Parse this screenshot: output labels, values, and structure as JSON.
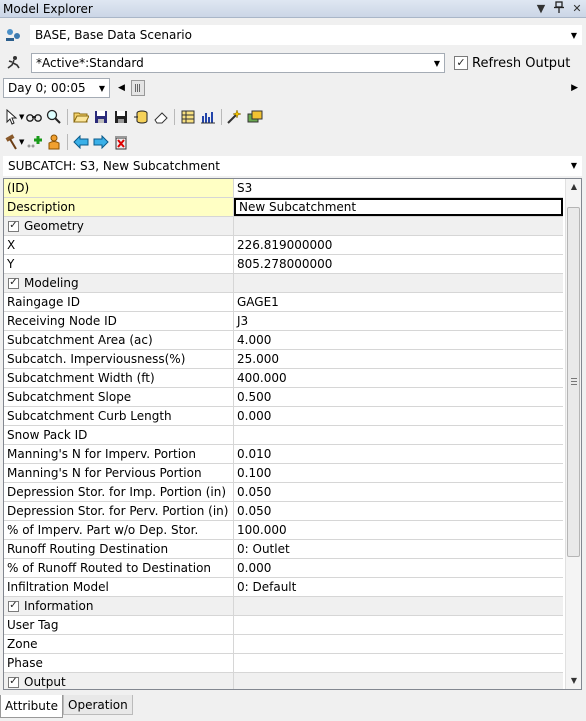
{
  "window": {
    "title": "Model Explorer",
    "pin_glyph": "ᵽ",
    "dropdown_glyph": "▼",
    "close_glyph": "✕"
  },
  "scenario": {
    "value": "BASE, Base Data Scenario"
  },
  "active_set": {
    "value": "*Active*:Standard",
    "refresh_label": "Refresh Output",
    "refresh_checked": true
  },
  "time": {
    "value": "Day 0;  00:05"
  },
  "selection": {
    "value": "SUBCATCH: S3, New Subcatchment"
  },
  "rows": [
    {
      "name": "(ID)",
      "value": "S3",
      "style": "yellow"
    },
    {
      "name": "Description",
      "value": "New Subcatchment",
      "style": "yellow-edit"
    },
    {
      "name": "Geometry",
      "category": true
    },
    {
      "name": "X",
      "value": "226.819000000"
    },
    {
      "name": "Y",
      "value": "805.278000000"
    },
    {
      "name": "Modeling",
      "category": true
    },
    {
      "name": "Raingage ID",
      "value": "GAGE1"
    },
    {
      "name": "Receiving Node ID",
      "value": "J3"
    },
    {
      "name": "Subcatchment Area (ac)",
      "value": "4.000"
    },
    {
      "name": "Subcatch. Imperviousness(%)",
      "value": "25.000"
    },
    {
      "name": "Subcatchment Width (ft)",
      "value": "400.000"
    },
    {
      "name": "Subcatchment Slope",
      "value": "0.500"
    },
    {
      "name": "Subcatchment Curb Length",
      "value": "0.000"
    },
    {
      "name": "Snow Pack ID",
      "value": ""
    },
    {
      "name": "Manning's N for Imperv. Portion",
      "value": "0.010"
    },
    {
      "name": "Manning's N for Pervious Portion",
      "value": "0.100"
    },
    {
      "name": "Depression Stor. for Imp. Portion (in)",
      "value": "0.050"
    },
    {
      "name": "Depression Stor. for Perv. Portion (in)",
      "value": "0.050"
    },
    {
      "name": "% of Imperv. Part w/o Dep. Stor.",
      "value": "100.000"
    },
    {
      "name": "Runoff Routing Destination",
      "value": "0: Outlet"
    },
    {
      "name": "% of Runoff Routed to Destination",
      "value": "0.000"
    },
    {
      "name": "Infiltration Model",
      "value": "0: Default"
    },
    {
      "name": "Information",
      "category": true
    },
    {
      "name": "User Tag",
      "value": ""
    },
    {
      "name": "Zone",
      "value": ""
    },
    {
      "name": "Phase",
      "value": ""
    },
    {
      "name": "Output",
      "category": true
    }
  ],
  "tabs": [
    {
      "label": "Attribute",
      "active": true
    },
    {
      "label": "Operation",
      "active": false
    }
  ],
  "colors": {
    "yellow": "#ffffc4",
    "title_bg": "#dfe7f2"
  }
}
